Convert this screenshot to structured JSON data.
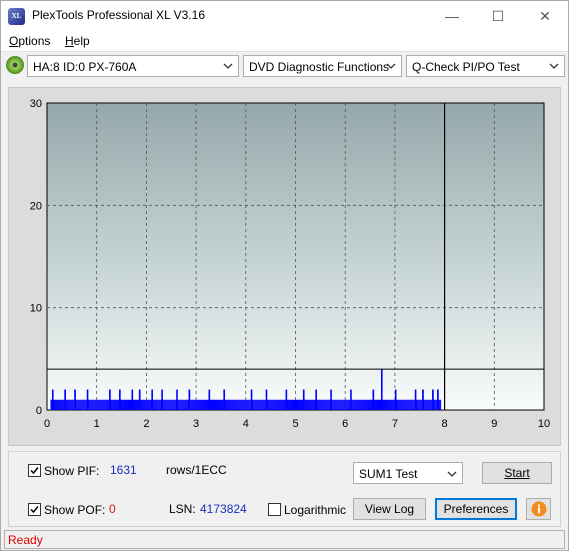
{
  "window": {
    "title": "PlexTools Professional XL V3.16",
    "icon_text": "XL",
    "minimize_glyph": "—",
    "maximize_glyph": "☐",
    "close_glyph": "✕"
  },
  "menu": {
    "options": {
      "first": "O",
      "rest": "ptions"
    },
    "help": {
      "first": "H",
      "rest": "elp"
    }
  },
  "toolbar": {
    "drive": "HA:8 ID:0  PX-760A",
    "function": "DVD Diagnostic Functions",
    "test": "Q-Check PI/PO Test"
  },
  "chart_data": {
    "type": "bar",
    "xlim": [
      0,
      10
    ],
    "ylim": [
      0,
      30
    ],
    "x_ticks": [
      "0",
      "1",
      "2",
      "3",
      "4",
      "5",
      "6",
      "7",
      "8",
      "9",
      "10"
    ],
    "y_ticks": [
      "0",
      "10",
      "20",
      "30"
    ],
    "grid": true,
    "marker_x": 8.0,
    "threshold_y": 4,
    "series": [
      {
        "color": "#0000ff",
        "x_range": [
          0.07,
          7.92
        ],
        "typical": 1,
        "peaks": [
          [
            0.1,
            2
          ],
          [
            0.35,
            2
          ],
          [
            0.55,
            2
          ],
          [
            0.8,
            2
          ],
          [
            1.25,
            2
          ],
          [
            1.45,
            2
          ],
          [
            1.7,
            2
          ],
          [
            1.85,
            2
          ],
          [
            2.1,
            2
          ],
          [
            2.3,
            2
          ],
          [
            2.6,
            2
          ],
          [
            2.85,
            2
          ],
          [
            3.25,
            2
          ],
          [
            3.55,
            2
          ],
          [
            4.1,
            2
          ],
          [
            4.4,
            2
          ],
          [
            4.8,
            2
          ],
          [
            5.15,
            2
          ],
          [
            5.4,
            2
          ],
          [
            5.7,
            2
          ],
          [
            6.1,
            2
          ],
          [
            6.55,
            2
          ],
          [
            6.72,
            4
          ],
          [
            7.0,
            2
          ],
          [
            7.4,
            2
          ],
          [
            7.55,
            2
          ],
          [
            7.75,
            2
          ],
          [
            7.85,
            2
          ]
        ]
      }
    ]
  },
  "controls": {
    "show_pif_label": "Show PIF:",
    "pif_value": "1631",
    "rows_label": "rows/1ECC",
    "show_pof_label": "Show POF:",
    "pof_value": "0",
    "lsn_label": "LSN:",
    "lsn_value": "4173824",
    "logarithmic_label": "Logarithmic",
    "sum_select": "SUM1 Test",
    "start_button": "Start",
    "view_log_button": "View Log",
    "preferences_button": "Preferences",
    "show_pif_checked": true,
    "show_pof_checked": true,
    "logarithmic_checked": false
  },
  "status": {
    "text": "Ready"
  }
}
